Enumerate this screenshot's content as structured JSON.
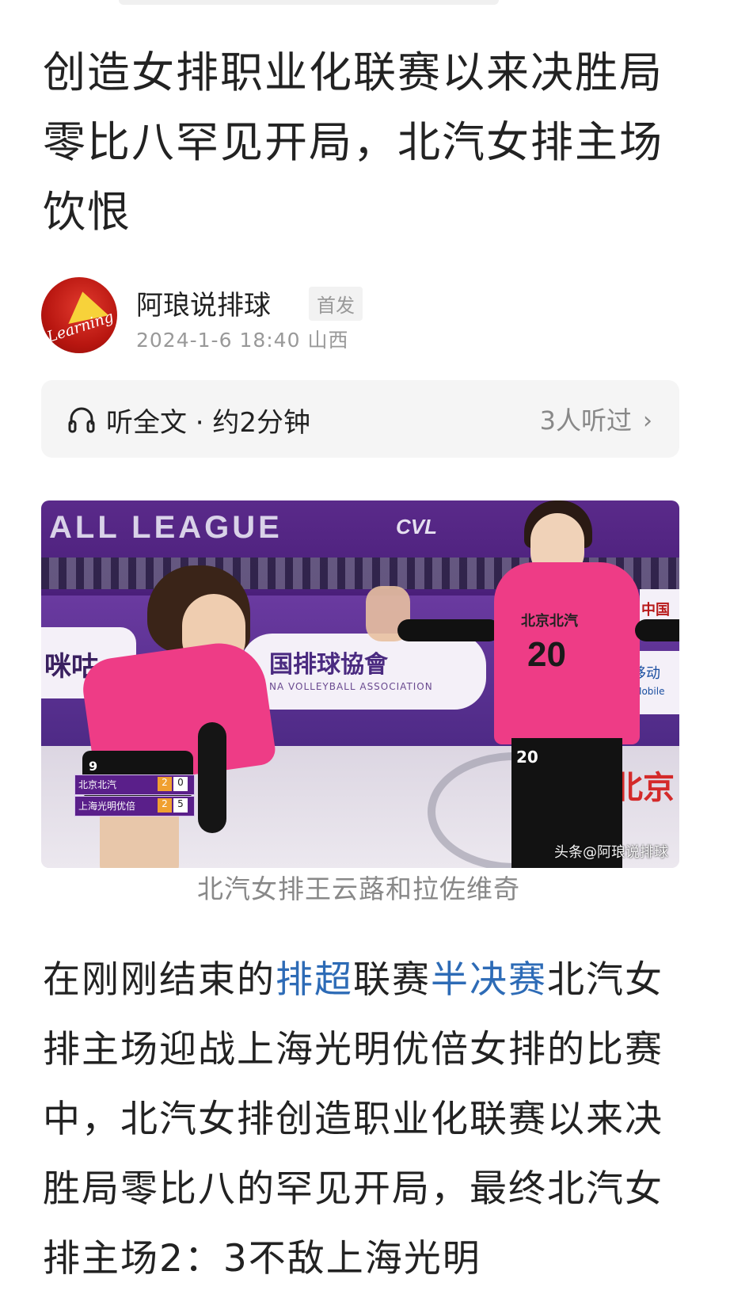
{
  "article": {
    "title": "创造女排职业化联赛以来决胜局零比八罕见开局，北汽女排主场饮恨",
    "author": {
      "name": "阿琅说排球",
      "badge": "首发",
      "avatar_text": "Learning",
      "date": "2024-1-6",
      "time": "18:40",
      "location": "山西"
    },
    "listen": {
      "label": "听全文 · 约2分钟",
      "count": "3人听过",
      "icon": "headphones-icon",
      "chevron": "chevron-right-icon"
    },
    "photo": {
      "league_text": "ALL LEAGUE",
      "cvl_text": "CVL",
      "board_left": "咪咕",
      "board_center": "国排球協會",
      "board_center_en": "NA VOLLEYBALL ASSOCIATION",
      "board_right_1": "中国移动",
      "board_right_2": "China Mobile",
      "board_right_top": "中国排",
      "floor_brand": "北京",
      "player1_number": "9",
      "player2_team": "北京北汽",
      "player2_number": "20",
      "player2_shorts_number": "20",
      "scoreboard": [
        {
          "team": "北京北汽",
          "sets": "2",
          "points": "0"
        },
        {
          "team": "上海光明优倍",
          "sets": "2",
          "points": "5"
        }
      ],
      "watermark": "头条@阿琅说排球"
    },
    "caption": "北汽女排王云蕗和拉佐维奇",
    "body": {
      "p1_pre": "在刚刚结束的",
      "link1": "排超",
      "p1_mid": "联赛",
      "link2": "半决赛",
      "p1_post": "北汽女排主场迎战上海光明优倍女排的比赛中，北汽女排创造职业化联赛以来决胜局零比八的罕见开局，最终北汽女排主场2：3不敌上海光明"
    },
    "colors": {
      "link": "#2d6bb6",
      "jersey": "#ee3c86",
      "banner": "#5a2a8a"
    }
  }
}
